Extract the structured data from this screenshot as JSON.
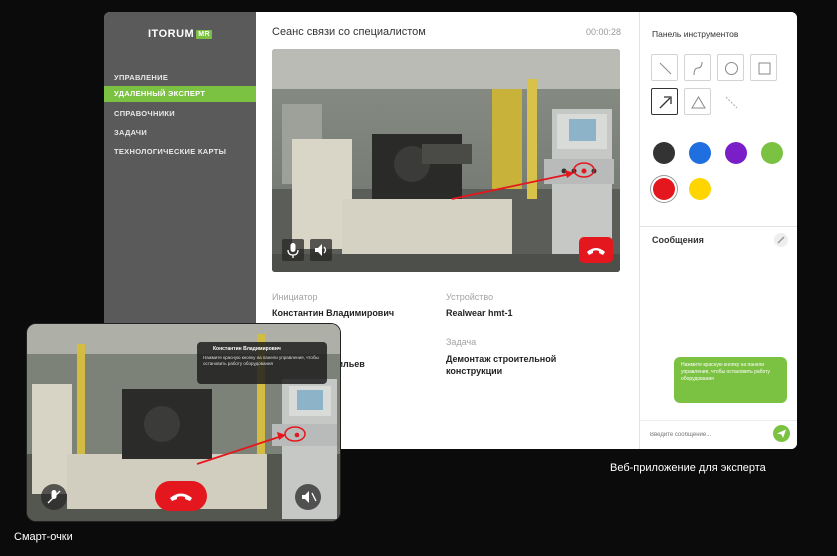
{
  "sidebar": {
    "logo": "ITORUM",
    "logo_badge": "MR",
    "items": [
      {
        "label": "УПРАВЛЕНИЕ",
        "active": false
      },
      {
        "label": "УДАЛЕННЫЙ ЭКСПЕРТ",
        "active": true
      },
      {
        "label": "СПРАВОЧНИКИ",
        "active": false
      },
      {
        "label": "ЗАДАЧИ",
        "active": false
      },
      {
        "label": "ТЕХНОЛОГИЧЕСКИЕ КАРТЫ",
        "active": false
      }
    ]
  },
  "session": {
    "title": "Сеанс связи со специалистом",
    "timer": "00:00:28"
  },
  "info": {
    "initiator_label": "Инициатор",
    "initiator_value": "Константин Владимирович",
    "device_label": "Устройство",
    "device_value": "Realwear hmt-1",
    "executor_value": "Васильев",
    "task_label": "Задача",
    "task_value": "Демонтаж строительной конструкции"
  },
  "tools": {
    "title": "Панель инструментов",
    "tool_icons": [
      "line-icon",
      "curve-icon",
      "circle-icon",
      "square-icon",
      "arrow-icon",
      "triangle-icon",
      "dashed-line-icon"
    ],
    "selected_tool": "arrow-icon",
    "colors": [
      "#333333",
      "#1f6fe0",
      "#7a1fc8",
      "#7cc242",
      "#e4171e",
      "#ffd500"
    ],
    "selected_color": "#e4171e"
  },
  "messages": {
    "title": "Сообщения",
    "bubble": "Нажмите красную кнопку на панели управления, чтобы остановить работу оборудования",
    "input_placeholder": "Введите сообщение..."
  },
  "glasses": {
    "notif_name": "Константин Владимирович",
    "notif_text": "Нажмите красную кнопку на панели управления, чтобы остановить работу оборудования"
  },
  "captions": {
    "web": "Веб-приложение для эксперта",
    "glasses": "Смарт-очки"
  },
  "colors": {
    "accent": "#7cc242",
    "sidebar_bg": "#5a5a5a",
    "hangup": "#e4171e"
  }
}
